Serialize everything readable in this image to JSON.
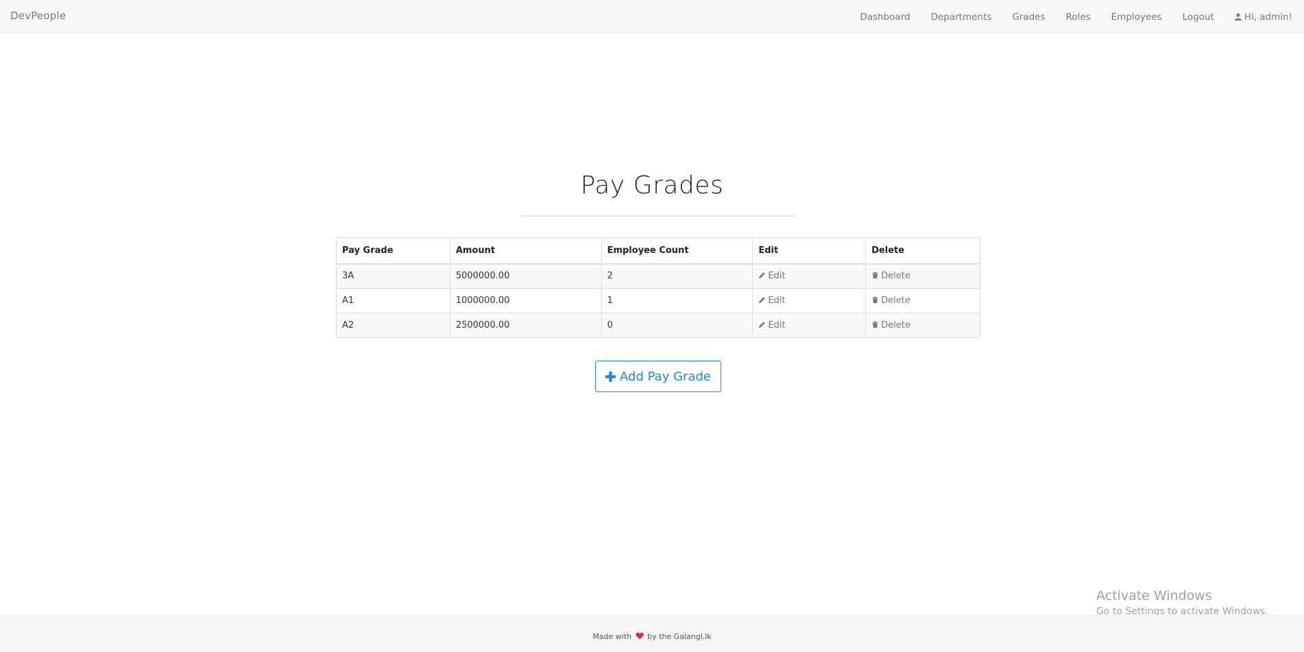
{
  "navbar": {
    "brand": "DevPeople",
    "links": [
      "Dashboard",
      "Departments",
      "Grades",
      "Roles",
      "Employees",
      "Logout"
    ],
    "user_greeting": "Hi, admin!",
    "user_icon": "user-icon"
  },
  "main": {
    "title": "Pay Grades",
    "table": {
      "headers": [
        "Pay Grade",
        "Amount",
        "Employee Count",
        "Edit",
        "Delete"
      ],
      "rows": [
        {
          "grade": "3A",
          "amount": "5000000.00",
          "count": "2",
          "edit": "Edit",
          "delete": "Delete"
        },
        {
          "grade": "A1",
          "amount": "1000000.00",
          "count": "1",
          "edit": "Edit",
          "delete": "Delete"
        },
        {
          "grade": "A2",
          "amount": "2500000.00",
          "count": "0",
          "edit": "Edit",
          "delete": "Delete"
        }
      ]
    },
    "add_button_label": "Add Pay Grade"
  },
  "watermark": {
    "title": "Activate Windows",
    "subtitle": "Go to Settings to activate Windows."
  },
  "footer": {
    "text_before": "Made with",
    "text_after": "by the Galangl.lk",
    "heart_color": "#e0245e"
  },
  "colors": {
    "accent": "#1a88e0",
    "navbar_bg": "#f8f8f8",
    "footer_bg": "#f5f5f5"
  }
}
